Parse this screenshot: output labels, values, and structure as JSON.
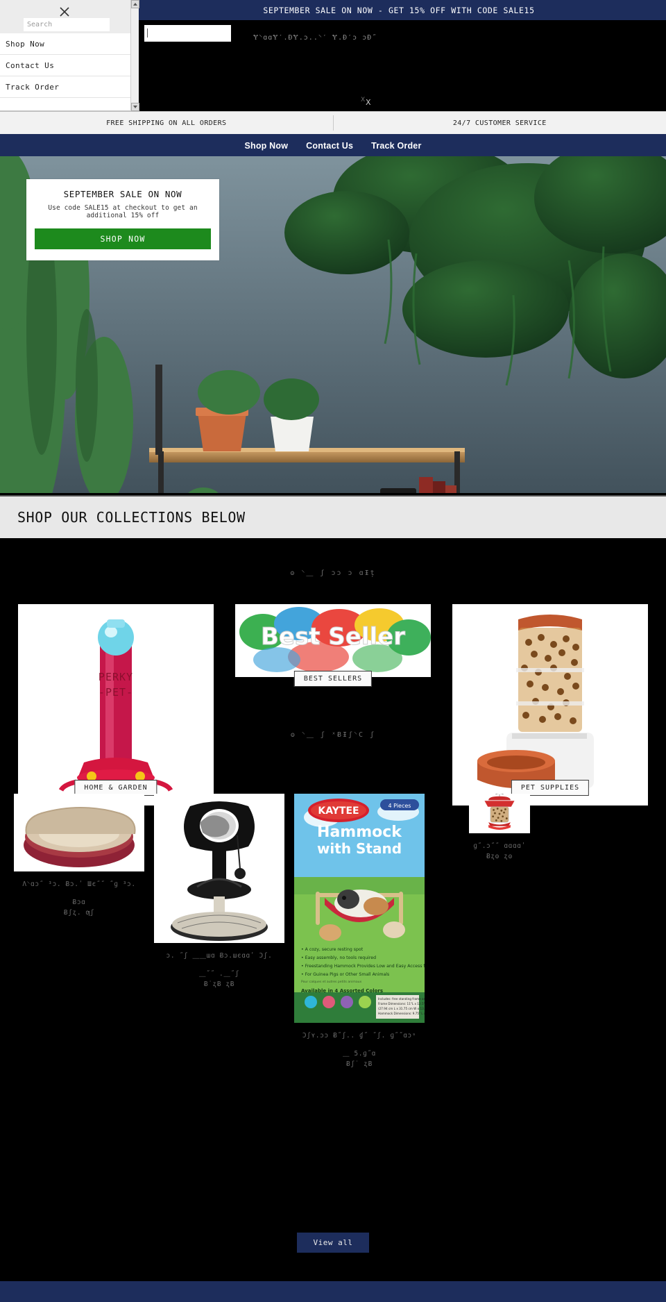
{
  "announcement": {
    "text": "SEPTEMBER SALE ON NOW - GET 15% OFF WITH CODE SALE15"
  },
  "header_artifacts": {
    "line_one": "Ɏ⸌ɑɑɎ′.ĐɎ.ɔ..⸌′  Ɏ.Đ′ɔ ɔĐ˝",
    "cursor_glyph": "Ⅹ"
  },
  "feature_strip": {
    "items": [
      "FREE SHIPPING ON ALL ORDERS",
      "24/7 CUSTOMER SERVICE"
    ]
  },
  "navbar": {
    "links": [
      {
        "label": "Shop Now"
      },
      {
        "label": "Contact Us"
      },
      {
        "label": "Track Order"
      }
    ]
  },
  "hero": {
    "promo": {
      "title": "SEPTEMBER SALE ON NOW",
      "subtitle": "Use code SALE15 at checkout to get an additional 15% off",
      "button_label": "SHOP NOW"
    }
  },
  "collections_band": {
    "heading": "SHOP OUR COLLECTIONS BELOW"
  },
  "collections": {
    "section_label": "ʘ ⸌⸏ ʃ ɔɔ   ɔ  ɑƗț",
    "cards": [
      {
        "badge": "HOME & GARDEN"
      },
      {
        "badge": "BEST SELLERS"
      },
      {
        "badge": "PET SUPPLIES"
      }
    ]
  },
  "products": {
    "section_label": "ʘ ⸌⸏ ʃ  ˣɃƗʃ⸌C ʃ",
    "items": [
      {
        "title": "Λ⸌ɑɔ˝ ³ɔ. Ƀɔ.ʹ Шє˝˝ ˝ɡ ³ɔ.",
        "title_line2": "Ƀɔɑ",
        "price": "Ƀʃʐ. ƣʃ"
      },
      {
        "title": "ɔ. ˝ʃ ⸏⸏шɑ Ƀɔ.шєɑɑʹ Ɔʃ.",
        "title_line2": "⸏˝˝ .⸏˝ʃ",
        "price": "Ƀ˙ʐɃ ʐɃ"
      },
      {
        "title": "Ɔʃʏ.ɔɔ Ƀ˝ʃ.. ɠ˝ ˝ʃ. ɡ˝˝ɑɔˢ",
        "title_line2": "⸏ 5.ɡ˝ɑ",
        "price": "Ƀʃ˙ ʐɃ"
      },
      {
        "title": "ɡ˝.ɔ˝˝  ɑɑɑɑʹ",
        "title_line2": "",
        "price": "Ƀʐʘ ʐʘ"
      }
    ],
    "view_all_label": "View all"
  },
  "drawer": {
    "close_icon": "close-icon",
    "search_placeholder": "Search",
    "search_value": "",
    "links": [
      {
        "label": "Shop Now"
      },
      {
        "label": "Contact Us"
      },
      {
        "label": "Track Order"
      }
    ]
  },
  "colors": {
    "navy": "#1d2d5c",
    "green": "#1d8a1d",
    "band": "#e8e8e8",
    "strip": "#f2f2f2"
  }
}
